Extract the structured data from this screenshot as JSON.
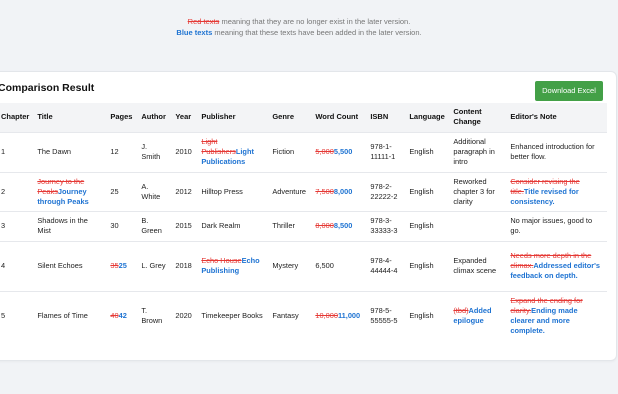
{
  "legend": {
    "line1_marker": "Red texts",
    "line1_text": " meaning that they are no longer exist in the later version.",
    "line2_marker": "Blue texts",
    "line2_text": " meaning that these texts have been added in the later version."
  },
  "header": {
    "title": "Comparison Result",
    "download_label": "Download Excel"
  },
  "columns": [
    "Chapter",
    "Title",
    "Pages",
    "Author",
    "Year",
    "Publisher",
    "Genre",
    "Word Count",
    "ISBN",
    "Language",
    "Content Change",
    "Editor's Note"
  ],
  "rows": [
    {
      "chapter": [
        {
          "t": "1"
        }
      ],
      "title": [
        {
          "t": "The Dawn"
        }
      ],
      "pages": [
        {
          "t": "12"
        }
      ],
      "author": [
        {
          "t": "J. Smith"
        }
      ],
      "year": [
        {
          "t": "2010"
        }
      ],
      "publisher": [
        {
          "t": "Light Publishers",
          "s": "del"
        },
        {
          "t": "Light Publications",
          "s": "add"
        }
      ],
      "genre": [
        {
          "t": "Fiction"
        }
      ],
      "word_count": [
        {
          "t": "5,000",
          "s": "del"
        },
        {
          "t": "5,500",
          "s": "add"
        }
      ],
      "isbn": [
        {
          "t": "978-1-11111-1"
        }
      ],
      "language": [
        {
          "t": "English"
        }
      ],
      "content_change": [
        {
          "t": "Additional paragraph in intro"
        }
      ],
      "note": [
        {
          "t": "Enhanced introduction for better flow."
        }
      ]
    },
    {
      "chapter": [
        {
          "t": "2"
        }
      ],
      "title": [
        {
          "t": "Journey to the Peaks",
          "s": "del"
        },
        {
          "t": "Journey through Peaks",
          "s": "add"
        }
      ],
      "pages": [
        {
          "t": "25"
        }
      ],
      "author": [
        {
          "t": "A. White"
        }
      ],
      "year": [
        {
          "t": "2012"
        }
      ],
      "publisher": [
        {
          "t": "Hilltop Press"
        }
      ],
      "genre": [
        {
          "t": "Adventure"
        }
      ],
      "word_count": [
        {
          "t": "7,500",
          "s": "del"
        },
        {
          "t": "8,000",
          "s": "add"
        }
      ],
      "isbn": [
        {
          "t": "978-2-22222-2"
        }
      ],
      "language": [
        {
          "t": "English"
        }
      ],
      "content_change": [
        {
          "t": "Reworked chapter 3 for clarity"
        }
      ],
      "note": [
        {
          "t": "Consider revising the title.",
          "s": "del"
        },
        {
          "t": "Title revised for consistency.",
          "s": "add"
        }
      ]
    },
    {
      "chapter": [
        {
          "t": "3"
        }
      ],
      "title": [
        {
          "t": "Shadows in the Mist"
        }
      ],
      "pages": [
        {
          "t": "30"
        }
      ],
      "author": [
        {
          "t": "B. Green"
        }
      ],
      "year": [
        {
          "t": "2015"
        }
      ],
      "publisher": [
        {
          "t": "Dark Realm"
        }
      ],
      "genre": [
        {
          "t": "Thriller"
        }
      ],
      "word_count": [
        {
          "t": "8,000",
          "s": "del"
        },
        {
          "t": "8,500",
          "s": "add"
        }
      ],
      "isbn": [
        {
          "t": "978-3-33333-3"
        }
      ],
      "language": [
        {
          "t": "English"
        }
      ],
      "content_change": [],
      "note": [
        {
          "t": "No major issues, good to go."
        }
      ]
    },
    {
      "chapter": [
        {
          "t": "4"
        }
      ],
      "title": [
        {
          "t": "Silent Echoes"
        }
      ],
      "pages": [
        {
          "t": "35",
          "s": "del"
        },
        {
          "t": "25",
          "s": "add"
        }
      ],
      "author": [
        {
          "t": "L. Grey"
        }
      ],
      "year": [
        {
          "t": "2018"
        }
      ],
      "publisher": [
        {
          "t": "Echo House",
          "s": "del"
        },
        {
          "t": "Echo Publishing",
          "s": "add"
        }
      ],
      "genre": [
        {
          "t": "Mystery"
        }
      ],
      "word_count": [
        {
          "t": "6,500"
        }
      ],
      "isbn": [
        {
          "t": "978-4-44444-4"
        }
      ],
      "language": [
        {
          "t": "English"
        }
      ],
      "content_change": [
        {
          "t": "Expanded climax scene"
        }
      ],
      "note": [
        {
          "t": "Needs more depth in the climax.",
          "s": "del"
        },
        {
          "t": "Addressed editor's feedback on depth.",
          "s": "add"
        }
      ]
    },
    {
      "chapter": [
        {
          "t": "5"
        }
      ],
      "title": [
        {
          "t": "Flames of Time"
        }
      ],
      "pages": [
        {
          "t": "40",
          "s": "del"
        },
        {
          "t": "42",
          "s": "add"
        }
      ],
      "author": [
        {
          "t": "T. Brown"
        }
      ],
      "year": [
        {
          "t": "2020"
        }
      ],
      "publisher": [
        {
          "t": "Timekeeper Books"
        }
      ],
      "genre": [
        {
          "t": "Fantasy"
        }
      ],
      "word_count": [
        {
          "t": "10,000",
          "s": "del"
        },
        {
          "t": "11,000",
          "s": "add"
        }
      ],
      "isbn": [
        {
          "t": "978-5-55555-5"
        }
      ],
      "language": [
        {
          "t": "English"
        }
      ],
      "content_change": [
        {
          "t": "(tbd)",
          "s": "del"
        },
        {
          "t": "Added epilogue",
          "s": "add"
        }
      ],
      "note": [
        {
          "t": "Expand the ending for clarity.",
          "s": "del"
        },
        {
          "t": "Ending made clearer and more complete.",
          "s": "add"
        }
      ]
    }
  ],
  "colors": {
    "deleted": "#e53935",
    "added": "#1e73d2",
    "download_button": "#43a047"
  }
}
